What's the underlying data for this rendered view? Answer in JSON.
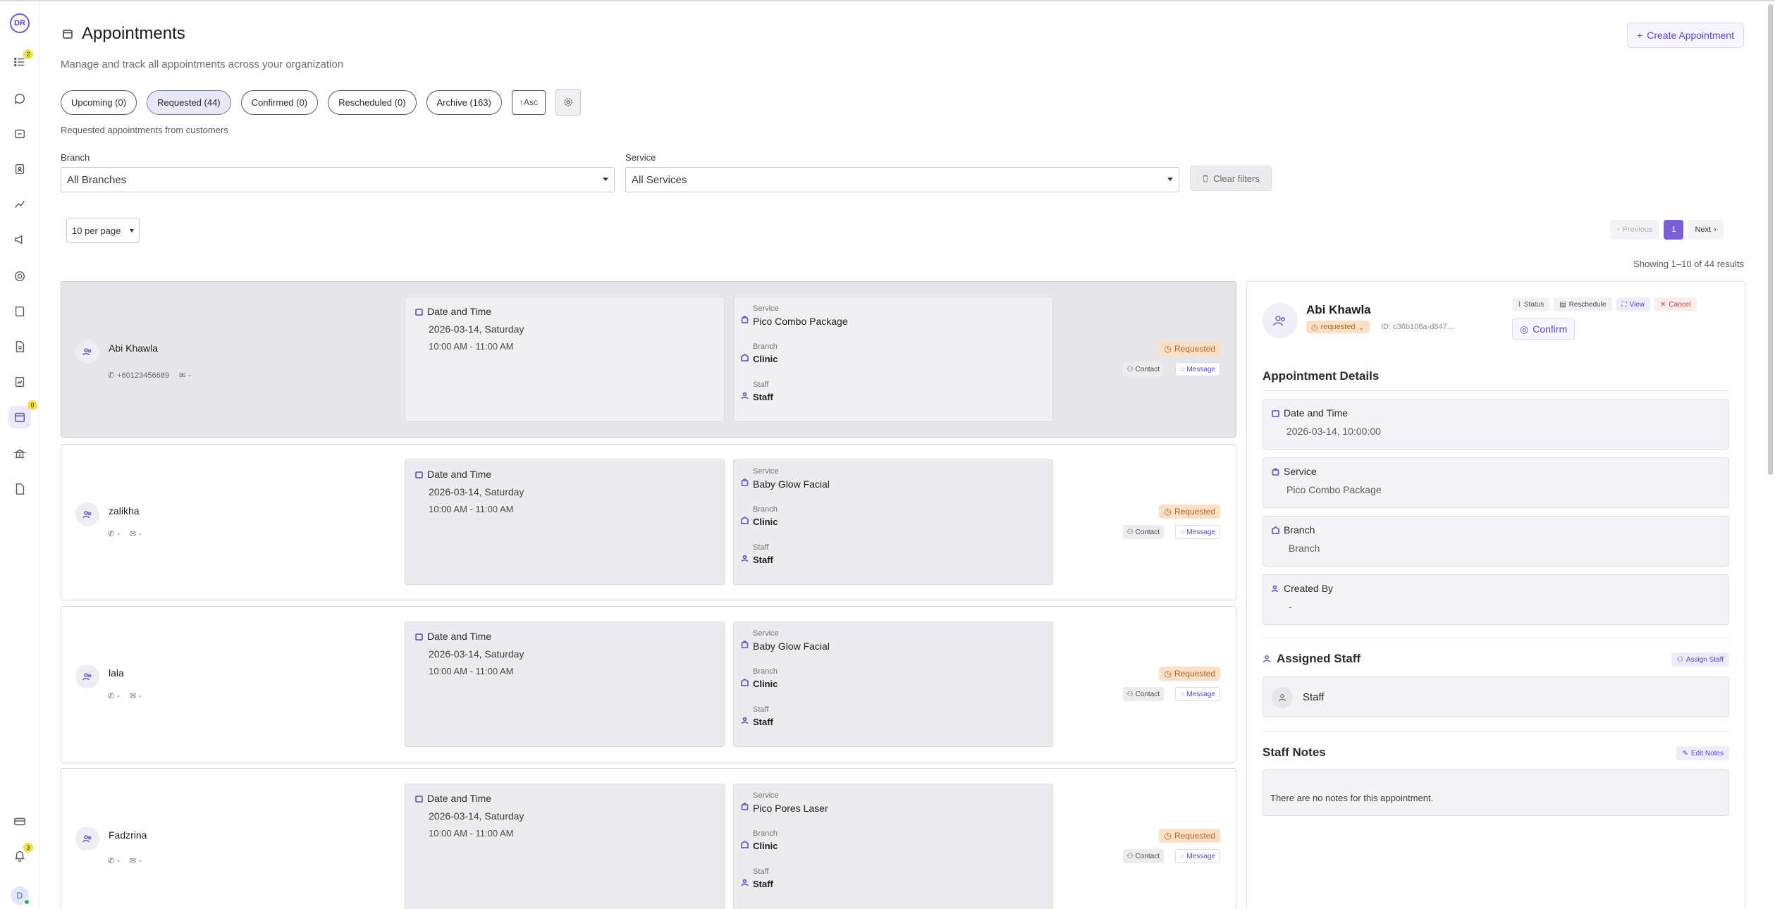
{
  "sidebar": {
    "logo": "DR",
    "badges": {
      "tasks": "2",
      "appointments": "0",
      "notifications": "3"
    },
    "user_initial": "D"
  },
  "header": {
    "title": "Appointments",
    "subtitle": "Manage and track all appointments across your organization",
    "create_label": "Create Appointment"
  },
  "tabs": [
    {
      "label": "Upcoming (0)"
    },
    {
      "label": "Requested (44)"
    },
    {
      "label": "Confirmed (0)"
    },
    {
      "label": "Rescheduled (0)"
    },
    {
      "label": "Archive (163)"
    }
  ],
  "sort_label": "↑Asc",
  "tab_description": "Requested appointments from customers",
  "filters": {
    "branch_label": "Branch",
    "branch_value": "All Branches",
    "service_label": "Service",
    "service_value": "All Services",
    "clear_label": "Clear filters"
  },
  "pagination": {
    "per_page": "10 per page",
    "previous": "Previous",
    "current": "1",
    "next": "Next",
    "results": "Showing 1–10 of 44 results"
  },
  "card_labels": {
    "date_time": "Date and Time",
    "service": "Service",
    "branch": "Branch",
    "staff": "Staff",
    "status": "Requested",
    "contact": "Contact",
    "message": "Message"
  },
  "appointments": [
    {
      "name": "Abi Khawla",
      "phone": "+60123456689",
      "email": "-",
      "date": "2026-03-14, Saturday",
      "time": "10:00 AM - 11:00 AM",
      "service": "Pico Combo Package",
      "branch": "Clinic",
      "staff": "Staff"
    },
    {
      "name": "zalikha",
      "phone": "-",
      "email": "-",
      "date": "2026-03-14, Saturday",
      "time": "10:00 AM - 11:00 AM",
      "service": "Baby Glow Facial",
      "branch": "Clinic",
      "staff": "Staff"
    },
    {
      "name": "lala",
      "phone": "-",
      "email": "-",
      "date": "2026-03-14, Saturday",
      "time": "10:00 AM - 11:00 AM",
      "service": "Baby Glow Facial",
      "branch": "Clinic",
      "staff": "Staff"
    },
    {
      "name": "Fadzrina",
      "phone": "-",
      "email": "-",
      "date": "2026-03-14, Saturday",
      "time": "10:00 AM - 11:00 AM",
      "service": "Pico Pores Laser",
      "branch": "Clinic",
      "staff": "Staff"
    }
  ],
  "panel": {
    "name": "Abi Khawla",
    "status": "requested",
    "id": "ID: c36b106a-d847...",
    "actions": {
      "status": "Status",
      "reschedule": "Reschedule",
      "view": "View",
      "cancel": "Cancel"
    },
    "confirm": "Confirm",
    "details_heading": "Appointment Details",
    "details": [
      {
        "label": "Date and Time",
        "value": "2026-03-14, 10:00:00"
      },
      {
        "label": "Service",
        "value": "Pico Combo Package"
      },
      {
        "label": "Branch",
        "value": "Branch"
      },
      {
        "label": "Created By",
        "value": "-"
      }
    ],
    "assigned_heading": "Assigned Staff",
    "assign_label": "Assign Staff",
    "staff_name": "Staff",
    "notes_heading": "Staff Notes",
    "edit_notes_label": "Edit Notes",
    "notes_text": "There are no notes for this appointment."
  },
  "colors": {
    "accent": "#5a49d0",
    "requested_bg": "#fbe0c6",
    "requested_fg": "#b46826"
  }
}
